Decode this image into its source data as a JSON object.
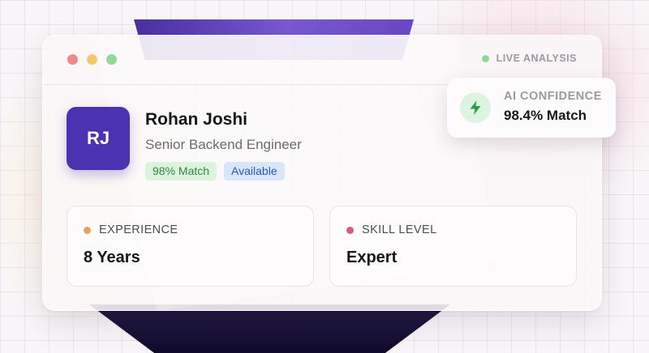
{
  "window": {
    "status_label": "LIVE ANALYSIS",
    "status_color": "#8fd89a"
  },
  "profile": {
    "initials": "RJ",
    "name": "Rohan Joshi",
    "title": "Senior Backend Engineer",
    "avatar_color": "#4b32b2",
    "badges": [
      {
        "label": "98% Match",
        "style": "success"
      },
      {
        "label": "Available",
        "style": "info"
      }
    ]
  },
  "stats": [
    {
      "label": "EXPERIENCE",
      "value": "8 Years",
      "dot_color": "#e8a35a"
    },
    {
      "label": "SKILL LEVEL",
      "value": "Expert",
      "dot_color": "#db5a7e"
    }
  ],
  "confidence": {
    "label": "AI CONFIDENCE",
    "value": "98.4% Match",
    "icon": "lightning-bolt-icon"
  }
}
